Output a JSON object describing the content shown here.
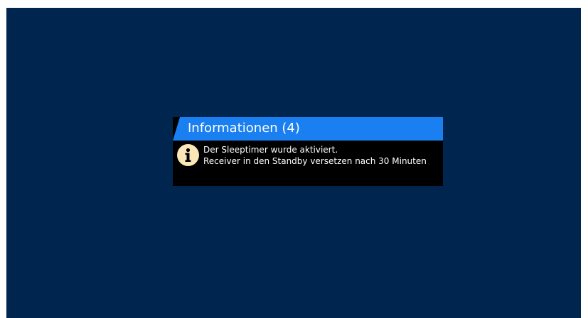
{
  "dialog": {
    "title": "Informationen (4)",
    "icon": "info-icon",
    "lines": [
      "Der Sleeptimer wurde aktiviert.",
      "Receiver in den Standby versetzen nach 30 Minuten"
    ]
  },
  "colors": {
    "background": "#002650",
    "header": "#1a7ff0",
    "dialog": "#000000",
    "icon": "#fbe7b8"
  }
}
